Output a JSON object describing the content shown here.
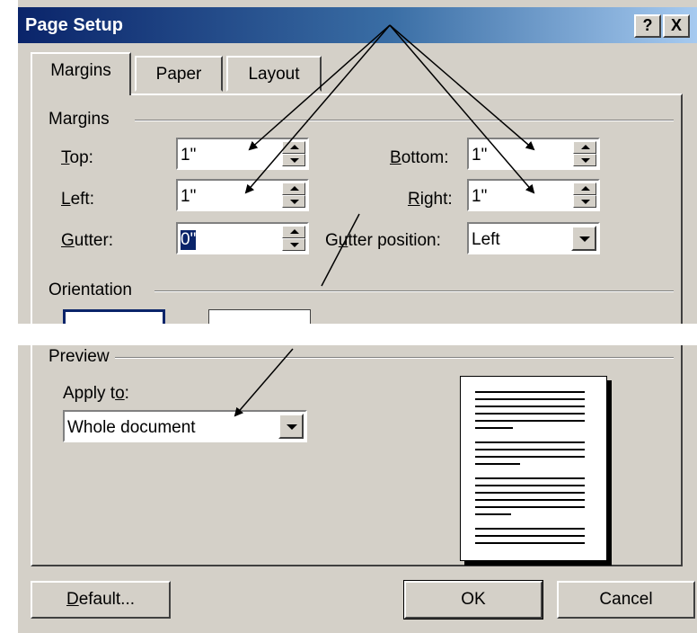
{
  "window": {
    "title": "Page Setup",
    "help_button": "?",
    "close_button": "X"
  },
  "tabs": [
    {
      "label": "Margins",
      "active": true
    },
    {
      "label": "Paper",
      "active": false
    },
    {
      "label": "Layout",
      "active": false
    }
  ],
  "margins_group": {
    "title": "Margins",
    "top": {
      "label_prefix": "T",
      "label_rest": "op:",
      "value": "1\""
    },
    "left": {
      "label_prefix": "L",
      "label_rest": "eft:",
      "value": "1\""
    },
    "gutter": {
      "label_prefix": "G",
      "label_rest": "utter:",
      "value": "0\""
    },
    "bottom": {
      "label_prefix": "B",
      "label_rest": "ottom:",
      "value": "1\""
    },
    "right": {
      "label_prefix": "R",
      "label_rest": "ight:",
      "value": "1\""
    },
    "gutter_position": {
      "label_a": "G",
      "label_u": "u",
      "label_b": "tter position:",
      "value": "Left"
    }
  },
  "orientation_group": {
    "title": "Orientation"
  },
  "preview_group": {
    "title": "Preview",
    "apply_to_label_a": "Apply t",
    "apply_to_label_u": "o",
    "apply_to_label_b": ":",
    "apply_to_value": "Whole document"
  },
  "buttons": {
    "default_u": "D",
    "default_rest": "efault...",
    "ok": "OK",
    "cancel": "Cancel"
  },
  "colors": {
    "dialog_face": "#d4d0c8",
    "title_start": "#0a246a",
    "title_end": "#a6caf0",
    "selection": "#0a246a"
  }
}
